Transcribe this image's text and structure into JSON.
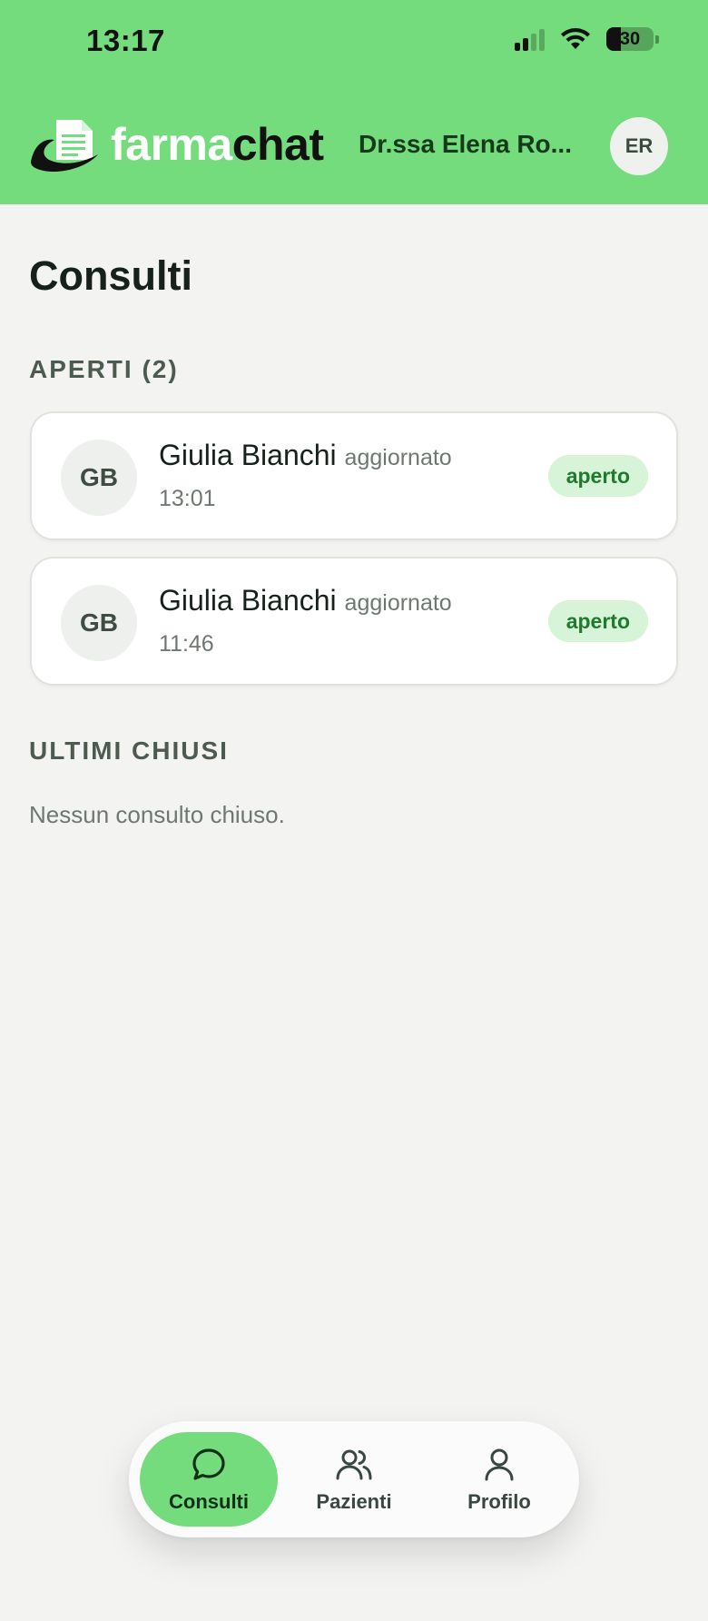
{
  "status_bar": {
    "time": "13:17",
    "battery": "30"
  },
  "header": {
    "brand_part1": "farma",
    "brand_part2": "chat",
    "user_name": "Dr.ssa Elena Ro...",
    "user_initials": "ER"
  },
  "page": {
    "title": "Consulti"
  },
  "open_section": {
    "label": "APERTI (2)",
    "items": [
      {
        "initials": "GB",
        "name": "Giulia Bianchi",
        "updated_label": "aggiornato",
        "time": "13:01",
        "status": "aperto"
      },
      {
        "initials": "GB",
        "name": "Giulia Bianchi",
        "updated_label": "aggiornato",
        "time": "11:46",
        "status": "aperto"
      }
    ]
  },
  "closed_section": {
    "label": "ULTIMI CHIUSI",
    "empty_text": "Nessun consulto chiuso."
  },
  "bottom_nav": {
    "items": [
      {
        "label": "Consulti",
        "icon": "chat-bubble-icon",
        "active": true
      },
      {
        "label": "Pazienti",
        "icon": "users-icon",
        "active": false
      },
      {
        "label": "Profilo",
        "icon": "user-icon",
        "active": false
      }
    ]
  },
  "colors": {
    "header_bg": "#74dc7c",
    "page_bg": "#f3f4f2",
    "badge_bg": "#d7f3d8",
    "badge_text": "#1f7a2c"
  }
}
